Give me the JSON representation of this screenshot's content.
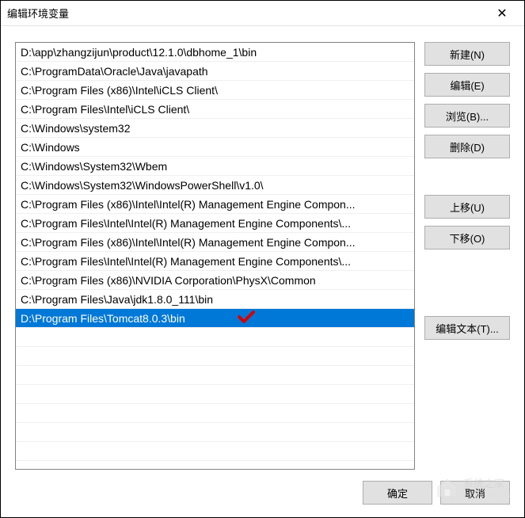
{
  "window": {
    "title": "编辑环境变量"
  },
  "paths": [
    "D:\\app\\zhangzijun\\product\\12.1.0\\dbhome_1\\bin",
    "C:\\ProgramData\\Oracle\\Java\\javapath",
    "C:\\Program Files (x86)\\Intel\\iCLS Client\\",
    "C:\\Program Files\\Intel\\iCLS Client\\",
    "C:\\Windows\\system32",
    "C:\\Windows",
    "C:\\Windows\\System32\\Wbem",
    "C:\\Windows\\System32\\WindowsPowerShell\\v1.0\\",
    "C:\\Program Files (x86)\\Intel\\Intel(R) Management Engine Compon...",
    "C:\\Program Files\\Intel\\Intel(R) Management Engine Components\\...",
    "C:\\Program Files (x86)\\Intel\\Intel(R) Management Engine Compon...",
    "C:\\Program Files\\Intel\\Intel(R) Management Engine Components\\...",
    "C:\\Program Files (x86)\\NVIDIA Corporation\\PhysX\\Common",
    "C:\\Program Files\\Java\\jdk1.8.0_111\\bin",
    "D:\\Program Files\\Tomcat8.0.3\\bin"
  ],
  "selectedIndex": 14,
  "buttons": {
    "new": "新建(N)",
    "edit": "编辑(E)",
    "browse": "浏览(B)...",
    "delete": "删除(D)",
    "moveUp": "上移(U)",
    "moveDown": "下移(O)",
    "editText": "编辑文本(T)...",
    "ok": "确定",
    "cancel": "取消"
  },
  "watermark": "系统之家"
}
